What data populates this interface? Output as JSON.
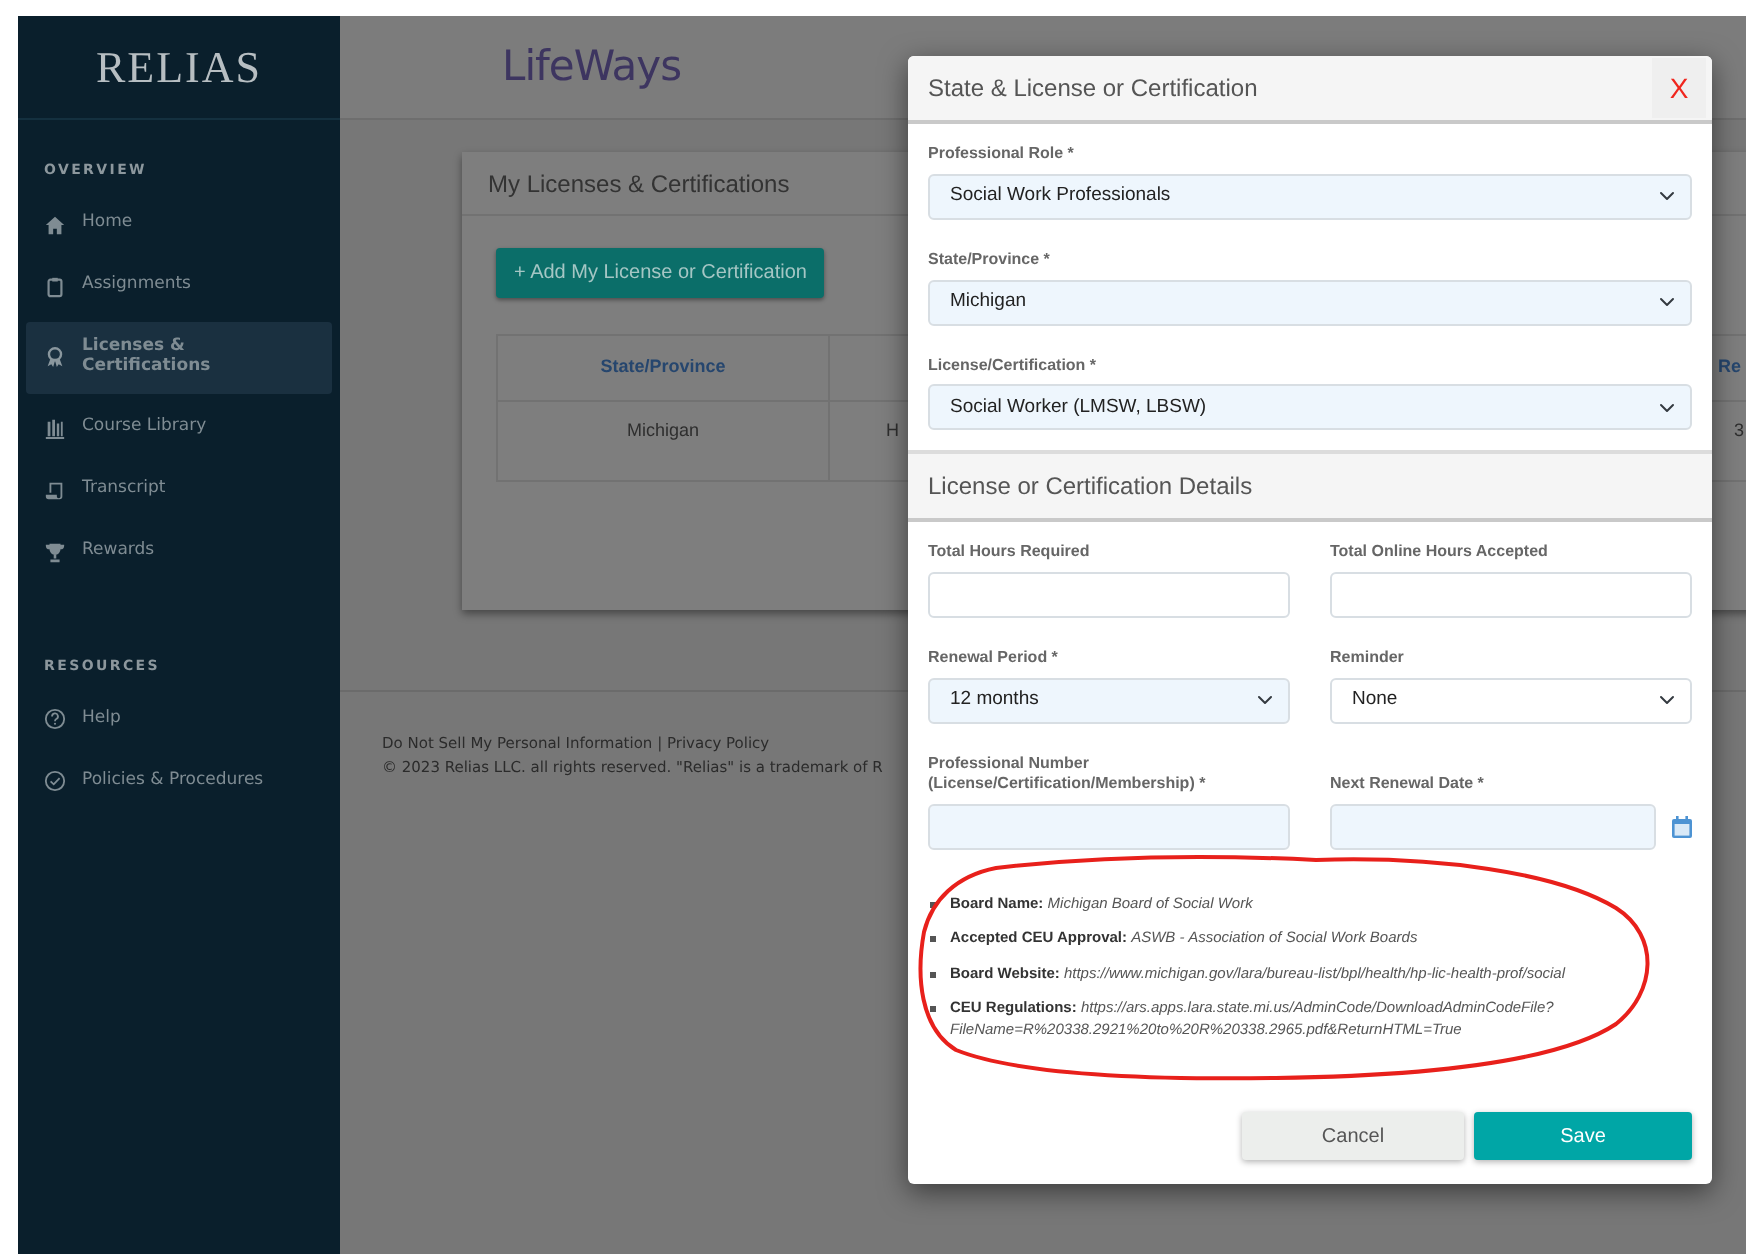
{
  "sidebar": {
    "logo": "RELIAS",
    "sections": [
      {
        "heading": "OVERVIEW",
        "items": [
          {
            "label": "Home",
            "selected": false
          },
          {
            "label": "Assignments",
            "selected": false
          },
          {
            "label": "Licenses & Certifications",
            "selected": true
          },
          {
            "label": "Course Library",
            "selected": false
          },
          {
            "label": "Transcript",
            "selected": false
          },
          {
            "label": "Rewards",
            "selected": false
          }
        ]
      },
      {
        "heading": "RESOURCES",
        "items": [
          {
            "label": "Help",
            "selected": false
          },
          {
            "label": "Policies & Procedures",
            "selected": false
          }
        ]
      }
    ]
  },
  "header": {
    "logo": "LifeWays"
  },
  "card": {
    "title": "My Licenses & Certifications",
    "add_button": "+ Add My License or Certification",
    "table": {
      "header": {
        "column_1": "State/Province",
        "column_3": "Re"
      },
      "rows": [
        {
          "column_1": "Michigan",
          "column_2": "H",
          "column_3": "3"
        }
      ]
    }
  },
  "footer": {
    "links": [
      "Do Not Sell My Personal Information",
      "Privacy Policy"
    ],
    "separator": "|",
    "copyright": "© 2023 Relias LLC. all rights reserved. \"Relias\" is a trademark of R"
  },
  "modal": {
    "title": "State & License or Certification",
    "close": "X",
    "fields": [
      {
        "label": "Professional Role *",
        "kind": "select",
        "value": "Social Work Professionals",
        "highlighted": true
      },
      {
        "label": "State/Province *",
        "kind": "select",
        "value": "Michigan",
        "highlighted": true
      },
      {
        "label": "License/Certification *",
        "kind": "select",
        "value": "Social Worker (LMSW, LBSW)",
        "highlighted": true
      }
    ],
    "details_title": "License or Certification Details",
    "details_fields": [
      {
        "label": "Total Hours Required",
        "kind": "input",
        "highlighted": false
      },
      {
        "label": "Total Online Hours Accepted",
        "kind": "input",
        "highlighted": false
      },
      {
        "label": "Renewal Period *",
        "kind": "select",
        "value": "12 months",
        "highlighted": true
      },
      {
        "label": "Reminder",
        "kind": "select",
        "value": "None",
        "highlighted": false
      },
      {
        "label": "Professional Number (License/Certification/Membership) *",
        "kind": "input",
        "highlighted": true
      },
      {
        "label": "Next Renewal Date *",
        "kind": "date",
        "highlighted": true
      }
    ],
    "info": [
      "**Board Name:** *Michigan Board of Social Work*",
      "**Accepted CEU Approval:** *ASWB - Association of Social Work Boards*",
      "**Board Website:** *https://www.michigan.gov/lara/bureau-list/bpl/health/hp-lic-health-prof/social*",
      "**CEU Regulations:** *https://ars.apps.lara.state.mi.us/AdminCode/DownloadAdminCodeFile?FileName=R%20338.2921%20to%20R%20338.2965.pdf&ReturnHTML=True*"
    ],
    "buttons": [
      {
        "label": "Cancel",
        "kind": "secondary"
      },
      {
        "label": "Save",
        "kind": "primary"
      }
    ]
  }
}
